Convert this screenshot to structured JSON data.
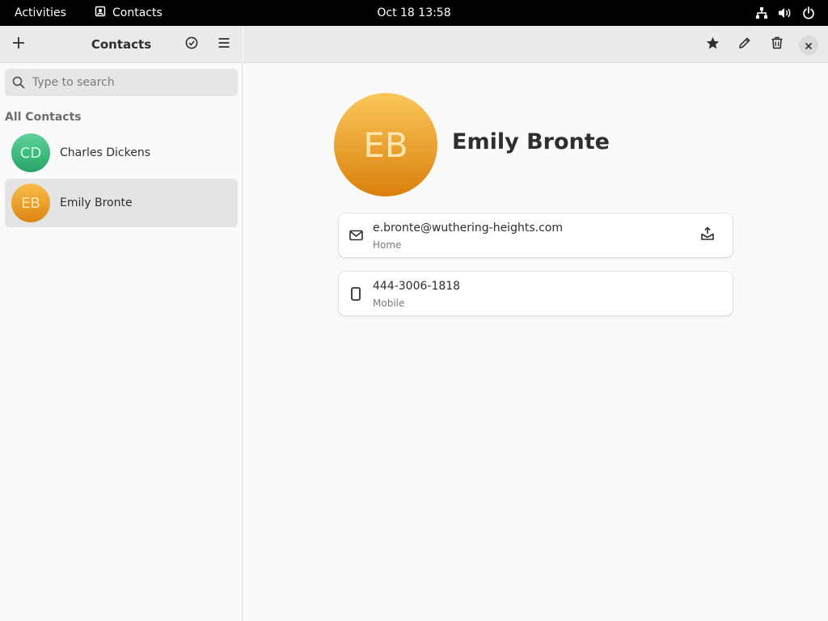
{
  "topbar": {
    "activities": "Activities",
    "app_name": "Contacts",
    "clock": "Oct 18  13:58"
  },
  "sidebar": {
    "title": "Contacts",
    "search_placeholder": "Type to search",
    "section_title": "All Contacts",
    "contacts": [
      {
        "initials": "CD",
        "name": "Charles Dickens",
        "color": "#3ab97a"
      },
      {
        "initials": "EB",
        "name": "Emily Bronte",
        "color": "#e8980f"
      }
    ]
  },
  "detail": {
    "initials": "EB",
    "name": "Emily Bronte",
    "fields": [
      {
        "value": "e.bronte@wuthering-heights.com",
        "label": "Home",
        "icon": "mail-icon"
      },
      {
        "value": "444-3006-1818",
        "label": "Mobile",
        "icon": "phone-icon"
      }
    ]
  },
  "colors": {
    "topbar_bg": "#000000",
    "header_bg": "#ebebeb",
    "selected_row": "#e4e4e4",
    "avatar_eb_top": "#fbc75a",
    "avatar_eb_bottom": "#d9800c"
  }
}
